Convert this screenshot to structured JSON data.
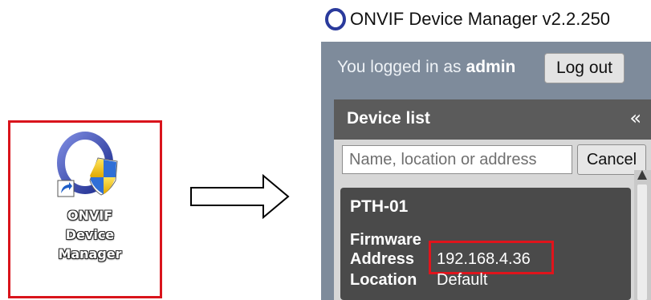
{
  "desktop_shortcut": {
    "label": "ONVIF\nDevice\nManager",
    "highlight_color": "#d9141c",
    "icon": "onvif-shield-icon"
  },
  "app": {
    "title": "ONVIF Device Manager v2.2.250",
    "logo_icon": "onvif-ring-icon",
    "login": {
      "prefix": "You logged in as",
      "user": "admin",
      "logout_label": "Log out"
    },
    "device_list": {
      "title": "Device list",
      "collapse_glyph": "«",
      "search_placeholder": "Name, location or address",
      "cancel_label": "Cancel",
      "devices": [
        {
          "name": "PTH-01",
          "firmware_label": "Firmware",
          "firmware": "",
          "address_label": "Address",
          "address": "192.168.4.36",
          "location_label": "Location",
          "location": "Default"
        }
      ]
    },
    "colors": {
      "body_bg": "#7e8b9b",
      "panel_header": "#5b5b5b",
      "card_bg": "#4a4a4a",
      "highlight": "#e0141c"
    }
  }
}
